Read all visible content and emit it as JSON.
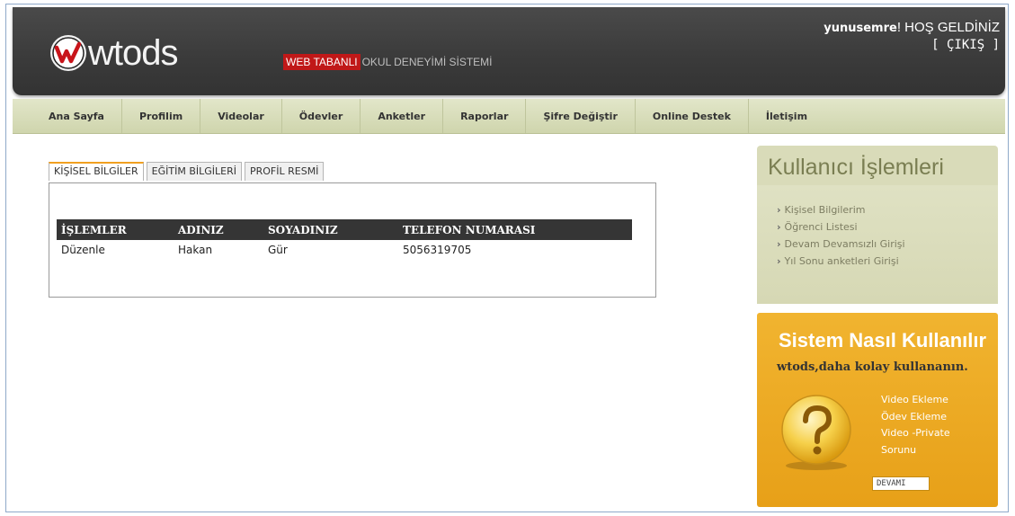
{
  "header": {
    "logo_text": "wtods",
    "tagline_highlight": "WEB TABANLI",
    "tagline_rest": "OKUL DENEYİMİ SİSTEMİ",
    "username": "yunusemre",
    "welcome_text": "! HOŞ GELDİNİZ",
    "logout_label": "[ ÇIKIŞ ]"
  },
  "nav": {
    "items": [
      "Ana Sayfa",
      "Profilim",
      "Videolar",
      "Ödevler",
      "Anketler",
      "Raporlar",
      "Şifre Değiştir",
      "Online Destek",
      "İletişim"
    ]
  },
  "tabs": [
    "KİŞİSEL BİLGİLER",
    "EĞİTİM BİLGİLERİ",
    "PROFİL RESMİ"
  ],
  "table": {
    "headers": [
      "İŞLEMLER",
      "ADINIZ",
      "SOYADINIZ",
      "TELEFON NUMARASI"
    ],
    "rows": [
      [
        "Düzenle",
        "Hakan",
        "Gür",
        "5056319705"
      ]
    ]
  },
  "sidebar": {
    "title": "Kullanıcı İşlemleri",
    "items": [
      "Kişisel Bilgilerim",
      "Öğrenci Listesi",
      "Devam Devamsızlı Girişi",
      "Yıl Sonu anketleri Girişi"
    ]
  },
  "help": {
    "title": "Sistem Nasıl Kullanılır",
    "subtitle": "wtods,daha kolay kullananın.",
    "links": [
      "Video Ekleme",
      "Ödev Ekleme",
      "Video -Private",
      "Sorunu"
    ],
    "more_label": "DEVAMI"
  },
  "colors": {
    "header_bg": "#3a3a3a",
    "nav_bg": "#d8ddb8",
    "accent_red": "#c01818",
    "help_orange": "#eaa520",
    "table_header": "#353535"
  },
  "icons": [
    "wtods-logo-icon",
    "question-mark-icon"
  ]
}
